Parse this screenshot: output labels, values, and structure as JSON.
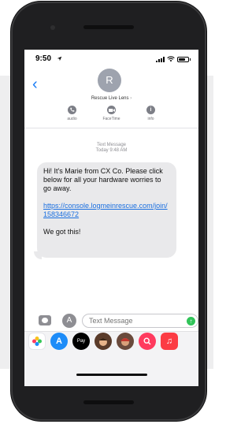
{
  "status_bar": {
    "time": "9:50"
  },
  "header": {
    "avatar_initial": "R",
    "contact_name": "Rescue Live Lens",
    "actions": [
      {
        "label": "audio",
        "icon": "phone-icon"
      },
      {
        "label": "FaceTime",
        "icon": "video-camera-icon"
      },
      {
        "label": "info",
        "icon": "info-icon"
      }
    ]
  },
  "conversation": {
    "meta_type": "Text Message",
    "meta_time": "Today 9:48 AM",
    "message": {
      "line1": "Hi! It's Marie from CX Co. Please click below for all your hardware worries to go away.",
      "link": "https://console.logmeinrescue.com/join/158346672",
      "line3": "We got this!"
    }
  },
  "composer": {
    "placeholder": "Text Message",
    "send_icon": "arrow-up-icon"
  },
  "app_drawer": [
    {
      "name": "photos"
    },
    {
      "name": "app-store",
      "glyph": "A"
    },
    {
      "name": "apple-pay",
      "glyph": "Pay"
    },
    {
      "name": "memoji"
    },
    {
      "name": "memoji-2"
    },
    {
      "name": "search"
    },
    {
      "name": "music",
      "glyph": "♫"
    }
  ],
  "colors": {
    "accent": "#1a7cf5",
    "bubble": "#e9e9eb",
    "send": "#31c459"
  }
}
